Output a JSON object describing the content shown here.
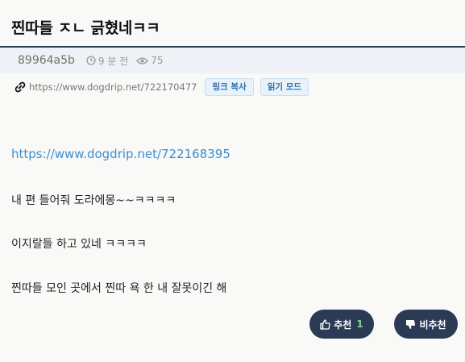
{
  "post": {
    "title": "찐따들 ㅈㄴ 긁혔네ㅋㅋ",
    "author": "89964a5b",
    "time": "9 분 전",
    "views": "75",
    "url": "https://www.dogdrip.net/722170477",
    "copy_link_label": "링크 복사",
    "read_mode_label": "읽기 모드",
    "body_link": "https://www.dogdrip.net/722168395",
    "lines": [
      "내 편 들어줘 도라에몽~~ㅋㅋㅋㅋ",
      "이지랄들 하고 있네 ㅋㅋㅋㅋ",
      "찐따들 모인 곳에서 찐따 욕 한 내 잘못이긴 해"
    ]
  },
  "actions": {
    "upvote_label": "추천",
    "upvote_count": "1",
    "downvote_label": "비추천"
  },
  "icons": {
    "clock": "clock-icon",
    "eye": "eye-icon",
    "link": "link-icon",
    "thumbs_up": "thumbs-up-icon",
    "thumbs_down": "thumbs-down-icon"
  },
  "colors": {
    "accent": "#2b3a55",
    "link": "#3d8fd0",
    "count": "#8fd18a"
  }
}
